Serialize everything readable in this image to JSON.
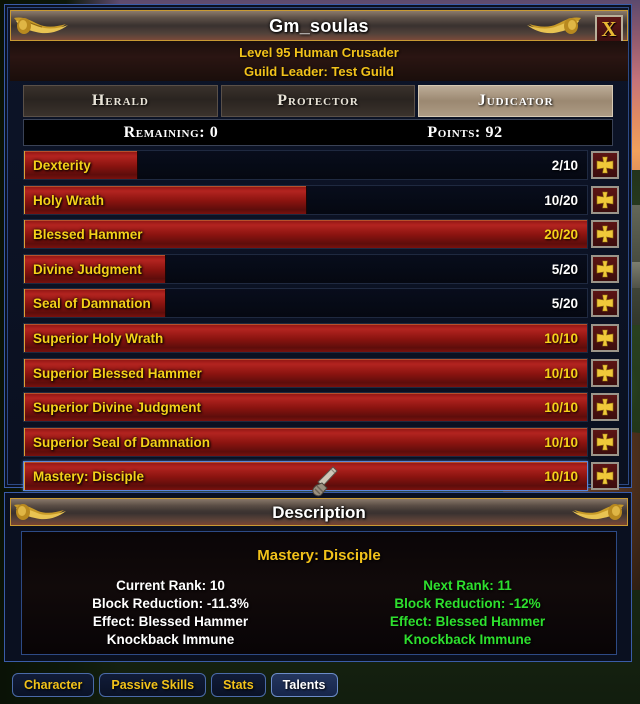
{
  "window": {
    "title": "Gm_soulas",
    "close_label": "X",
    "character_line1": "Level 95 Human Crusader",
    "character_line2": "Guild Leader: Test Guild"
  },
  "spec_tabs": [
    {
      "label": "Herald",
      "active": false
    },
    {
      "label": "Protector",
      "active": false
    },
    {
      "label": "Judicator",
      "active": true
    }
  ],
  "points": {
    "remaining_label": "Remaining: 0",
    "points_label": "Points: 92"
  },
  "skills": [
    {
      "name": "Dexterity",
      "value": "2/10",
      "rank": 2,
      "max": 10,
      "maxed": false,
      "selected": false,
      "icon": "maltese-cross-icon"
    },
    {
      "name": "Holy Wrath",
      "value": "10/20",
      "rank": 10,
      "max": 20,
      "maxed": false,
      "selected": false,
      "icon": "maltese-cross-icon"
    },
    {
      "name": "Blessed Hammer",
      "value": "20/20",
      "rank": 20,
      "max": 20,
      "maxed": true,
      "selected": false,
      "icon": "maltese-cross-icon"
    },
    {
      "name": "Divine Judgment",
      "value": "5/20",
      "rank": 5,
      "max": 20,
      "maxed": false,
      "selected": false,
      "icon": "maltese-cross-icon"
    },
    {
      "name": "Seal of Damnation",
      "value": "5/20",
      "rank": 5,
      "max": 20,
      "maxed": false,
      "selected": false,
      "icon": "maltese-cross-icon"
    },
    {
      "name": "Superior Holy Wrath",
      "value": "10/10",
      "rank": 10,
      "max": 10,
      "maxed": true,
      "selected": false,
      "icon": "maltese-cross-icon"
    },
    {
      "name": "Superior Blessed Hammer",
      "value": "10/10",
      "rank": 10,
      "max": 10,
      "maxed": true,
      "selected": false,
      "icon": "maltese-cross-icon"
    },
    {
      "name": "Superior Divine Judgment",
      "value": "10/10",
      "rank": 10,
      "max": 10,
      "maxed": true,
      "selected": false,
      "icon": "maltese-cross-icon"
    },
    {
      "name": "Superior Seal of Damnation",
      "value": "10/10",
      "rank": 10,
      "max": 10,
      "maxed": true,
      "selected": false,
      "icon": "maltese-cross-icon"
    },
    {
      "name": "Mastery: Disciple",
      "value": "10/10",
      "rank": 10,
      "max": 10,
      "maxed": true,
      "selected": true,
      "icon": "maltese-cross-icon"
    }
  ],
  "description": {
    "header": "Description",
    "skill_name": "Mastery: Disciple",
    "current": [
      "Current Rank: 10",
      "Block Reduction: -11.3%",
      "Effect: Blessed Hammer",
      "Knockback Immune"
    ],
    "next": [
      "Next Rank: 11",
      "Block Reduction: -12%",
      "Effect: Blessed Hammer",
      "Knockback Immune"
    ]
  },
  "bottom_tabs": [
    {
      "label": "Character",
      "active": false
    },
    {
      "label": "Passive Skills",
      "active": false
    },
    {
      "label": "Stats",
      "active": false
    },
    {
      "label": "Talents",
      "active": true
    }
  ],
  "colors": {
    "gold_text": "#f2c21a",
    "bar_red": "#b32420",
    "next_rank_green": "#2ee02e",
    "frame_blue": "#3a5ca8",
    "frame_gold": "#c99a33"
  }
}
